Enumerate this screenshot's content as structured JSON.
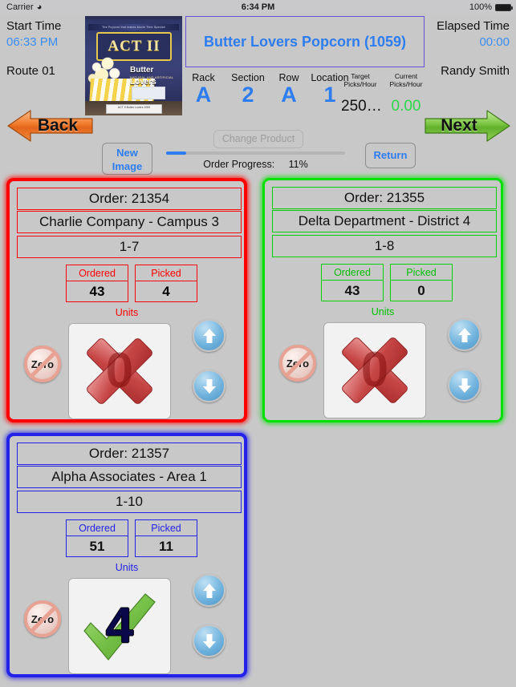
{
  "statusbar": {
    "carrier": "Carrier",
    "wifi_icon": "wifi-icon",
    "time": "6:34 PM",
    "battery_pct": "100%"
  },
  "header": {
    "start_time_label": "Start Time",
    "start_time_value": "06:33 PM",
    "route_label": "Route 01",
    "elapsed_label": "Elapsed Time",
    "elapsed_value": "00:00",
    "user_name": "Randy Smith",
    "product_title": "Butter Lovers Popcorn (1059)",
    "product_image": {
      "brand": "ACT II",
      "flavor": "Butter Lovers",
      "subtitle": "NATURAL AND ARTIFICIAL FLAVOR",
      "top_banner": "The Popcorn that makes Movie Time Special!",
      "shelf_tag": "ACT II Butter Lovers 1059"
    },
    "location": {
      "rack_label": "Rack",
      "rack_value": "A",
      "section_label": "Section",
      "section_value": "2",
      "row_label": "Row",
      "row_value": "A",
      "location_label": "Location",
      "location_value": "1"
    },
    "picks": {
      "target_label_1": "Target",
      "target_label_2": "Picks/Hour",
      "target_value": "250…",
      "current_label_1": "Current",
      "current_label_2": "Picks/Hour",
      "current_value": "0.00"
    },
    "back_button": "Back",
    "next_button": "Next",
    "new_image_line1": "New",
    "new_image_line2": "Image",
    "change_product_button": "Change Product",
    "return_button": "Return",
    "order_progress_label": "Order Progress:",
    "order_progress_value": "11%",
    "order_progress_pct": 11,
    "colors": {
      "accent_blue": "#2e7df0",
      "green": "#2bd94a",
      "purple_border": "#6a4fd8"
    }
  },
  "cards": [
    {
      "order": "Order: 21354",
      "customer": "Charlie Company - Campus 3",
      "route_stop": "1-7",
      "ordered_label": "Ordered",
      "ordered_value": "43",
      "picked_label": "Picked",
      "picked_value": "4",
      "units_label": "Units",
      "qty_display": "0",
      "qty_state": "x-mark",
      "zero_button": "Zero",
      "color": "#ff0000"
    },
    {
      "order": "Order: 21355",
      "customer": "Delta Department - District 4",
      "route_stop": "1-8",
      "ordered_label": "Ordered",
      "ordered_value": "43",
      "picked_label": "Picked",
      "picked_value": "0",
      "units_label": "Units",
      "qty_display": "0",
      "qty_state": "x-mark",
      "zero_button": "Zero",
      "color": "#00e000"
    },
    {
      "order": "Order: 21357",
      "customer": "Alpha Associates - Area 1",
      "route_stop": "1-10",
      "ordered_label": "Ordered",
      "ordered_value": "51",
      "picked_label": "Picked",
      "picked_value": "11",
      "units_label": "Units",
      "qty_display": "4",
      "qty_state": "check-mark",
      "zero_button": "Zero",
      "color": "#2222e8"
    }
  ]
}
